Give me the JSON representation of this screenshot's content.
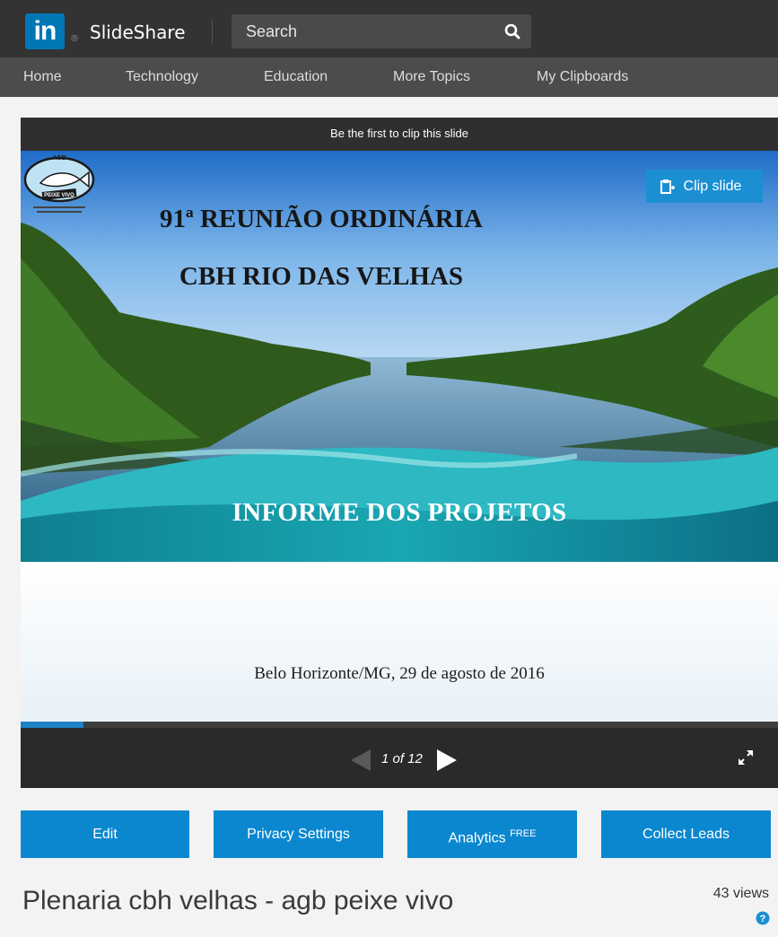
{
  "header": {
    "logo_text": "in",
    "logo_reg": "®",
    "brand": "SlideShare",
    "search_placeholder": "Search"
  },
  "nav": {
    "items": [
      "Home",
      "Technology",
      "Education",
      "More Topics",
      "My Clipboards"
    ]
  },
  "player": {
    "clip_hint": "Be the first to clip this slide",
    "clip_button": "Clip slide",
    "page_indicator": "1 of 12",
    "progress_fraction": 0.083
  },
  "slide": {
    "title_line1": "91ª REUNIÃO ORDINÁRIA",
    "title_line2": "CBH RIO DAS VELHAS",
    "subtitle": "INFORME DOS PROJETOS",
    "logo_text_top": "AGB",
    "logo_text_banner": "PEIXE VIVO",
    "location": "Belo Horizonte/MG, 29 de agosto de 2016"
  },
  "actions": {
    "edit": "Edit",
    "privacy": "Privacy Settings",
    "analytics": "Analytics",
    "analytics_badge": "FREE",
    "collect_leads": "Collect Leads"
  },
  "document": {
    "title": "Plenaria cbh velhas - agb peixe vivo",
    "views": "43 views"
  },
  "colors": {
    "accent": "#0b87cf",
    "topbar": "#333333",
    "navbar": "#4c4c4c"
  }
}
